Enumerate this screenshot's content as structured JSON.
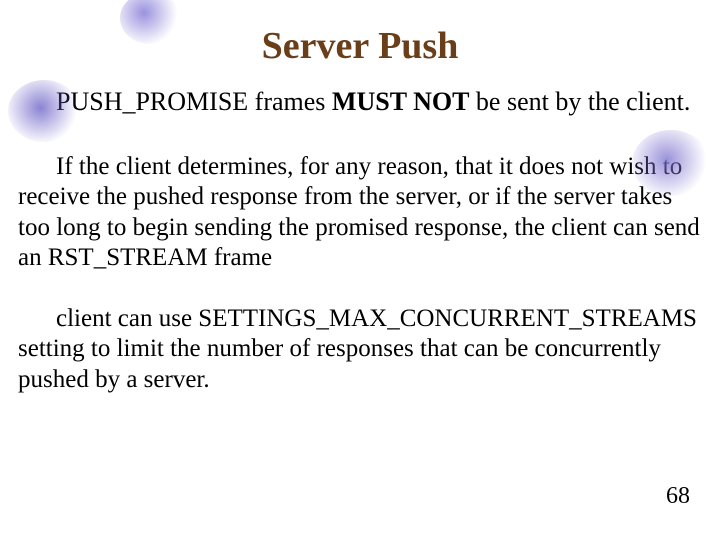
{
  "title": "Server Push",
  "p1": {
    "lead": "PUSH_PROMISE frames ",
    "emph": "MUST NOT",
    "tail": " be sent by the client."
  },
  "p2": "If the client determines, for any reason, that it does not wish to receive the pushed response from the server, or if the server takes too long to begin sending the promised response, the client can send an  RST_STREAM frame",
  "p3": "client can use  SETTINGS_MAX_CONCURRENT_STREAMS setting to limit the number of responses that can be concurrently pushed by a server.",
  "pageNumber": "68"
}
